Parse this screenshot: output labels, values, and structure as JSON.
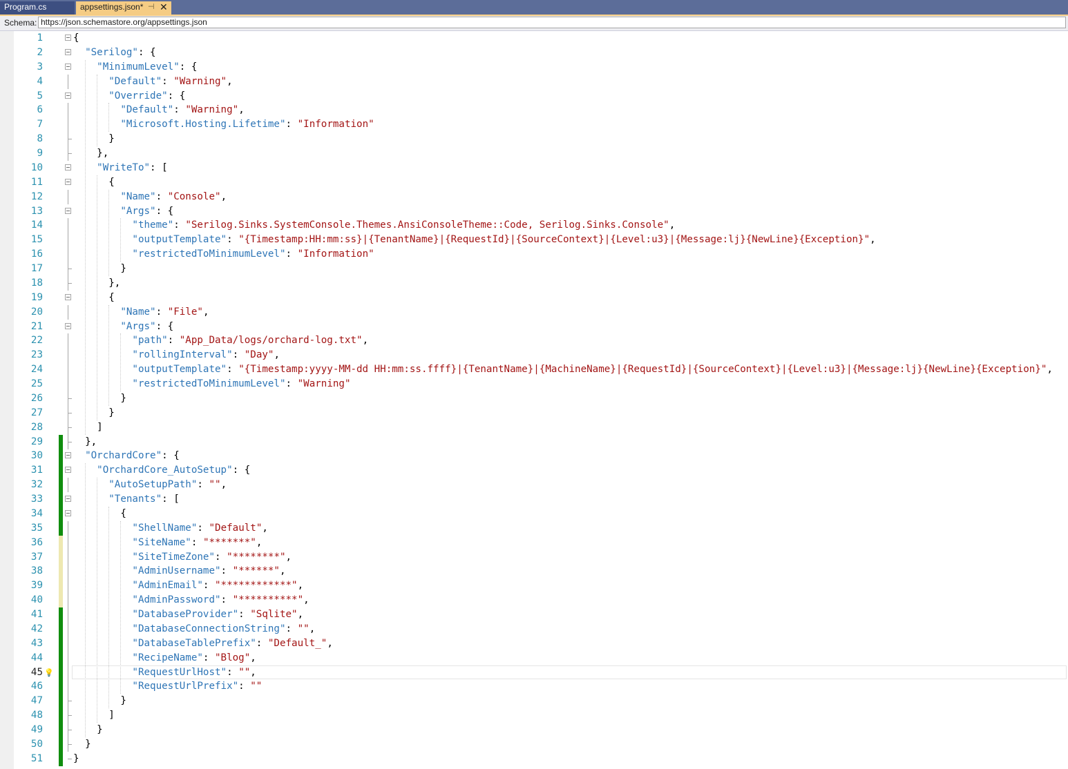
{
  "tabs": [
    {
      "label": "Program.cs"
    },
    {
      "label": "appsettings.json*",
      "pin": "⊣",
      "close": "✕"
    }
  ],
  "schema": {
    "label": "Schema:",
    "value": "https://json.schemastore.org/appsettings.json"
  },
  "editor": {
    "current_line": 45,
    "colors": {
      "key": "#2e75b6",
      "string": "#a31515",
      "punct": "#000000",
      "line_number": "#2b91af",
      "change_saved": "#108d0e",
      "change_unsaved": "#eee8b1"
    },
    "fold_markers": [
      1,
      2,
      3,
      5,
      10,
      11,
      13,
      19,
      21,
      30,
      31,
      33,
      34
    ],
    "saved_change_lines": [
      29,
      30,
      31,
      32,
      33,
      34,
      35,
      41,
      42,
      43,
      44,
      45,
      46,
      47,
      48,
      49,
      50,
      51
    ],
    "unsaved_change_lines": [
      36,
      37,
      38,
      39,
      40
    ],
    "lines": [
      {
        "n": "1",
        "tokens": [
          [
            "p",
            "{"
          ]
        ]
      },
      {
        "n": "2",
        "tokens": [
          [
            "p",
            "  "
          ],
          [
            "k",
            "\"Serilog\""
          ],
          [
            "p",
            ": {"
          ]
        ]
      },
      {
        "n": "3",
        "tokens": [
          [
            "p",
            "    "
          ],
          [
            "k",
            "\"MinimumLevel\""
          ],
          [
            "p",
            ": {"
          ]
        ]
      },
      {
        "n": "4",
        "tokens": [
          [
            "p",
            "      "
          ],
          [
            "k",
            "\"Default\""
          ],
          [
            "p",
            ": "
          ],
          [
            "s",
            "\"Warning\""
          ],
          [
            "p",
            ","
          ]
        ]
      },
      {
        "n": "5",
        "tokens": [
          [
            "p",
            "      "
          ],
          [
            "k",
            "\"Override\""
          ],
          [
            "p",
            ": {"
          ]
        ]
      },
      {
        "n": "6",
        "tokens": [
          [
            "p",
            "        "
          ],
          [
            "k",
            "\"Default\""
          ],
          [
            "p",
            ": "
          ],
          [
            "s",
            "\"Warning\""
          ],
          [
            "p",
            ","
          ]
        ]
      },
      {
        "n": "7",
        "tokens": [
          [
            "p",
            "        "
          ],
          [
            "k",
            "\"Microsoft.Hosting.Lifetime\""
          ],
          [
            "p",
            ": "
          ],
          [
            "s",
            "\"Information\""
          ]
        ]
      },
      {
        "n": "8",
        "tokens": [
          [
            "p",
            "      }"
          ]
        ]
      },
      {
        "n": "9",
        "tokens": [
          [
            "p",
            "    },"
          ]
        ]
      },
      {
        "n": "10",
        "tokens": [
          [
            "p",
            "    "
          ],
          [
            "k",
            "\"WriteTo\""
          ],
          [
            "p",
            ": ["
          ]
        ]
      },
      {
        "n": "11",
        "tokens": [
          [
            "p",
            "      {"
          ]
        ]
      },
      {
        "n": "12",
        "tokens": [
          [
            "p",
            "        "
          ],
          [
            "k",
            "\"Name\""
          ],
          [
            "p",
            ": "
          ],
          [
            "s",
            "\"Console\""
          ],
          [
            "p",
            ","
          ]
        ]
      },
      {
        "n": "13",
        "tokens": [
          [
            "p",
            "        "
          ],
          [
            "k",
            "\"Args\""
          ],
          [
            "p",
            ": {"
          ]
        ]
      },
      {
        "n": "14",
        "tokens": [
          [
            "p",
            "          "
          ],
          [
            "k",
            "\"theme\""
          ],
          [
            "p",
            ": "
          ],
          [
            "s",
            "\"Serilog.Sinks.SystemConsole.Themes.AnsiConsoleTheme::Code, Serilog.Sinks.Console\""
          ],
          [
            "p",
            ","
          ]
        ]
      },
      {
        "n": "15",
        "tokens": [
          [
            "p",
            "          "
          ],
          [
            "k",
            "\"outputTemplate\""
          ],
          [
            "p",
            ": "
          ],
          [
            "s",
            "\"{Timestamp:HH:mm:ss}|{TenantName}|{RequestId}|{SourceContext}|{Level:u3}|{Message:lj}{NewLine}{Exception}\""
          ],
          [
            "p",
            ","
          ]
        ]
      },
      {
        "n": "16",
        "tokens": [
          [
            "p",
            "          "
          ],
          [
            "k",
            "\"restrictedToMinimumLevel\""
          ],
          [
            "p",
            ": "
          ],
          [
            "s",
            "\"Information\""
          ]
        ]
      },
      {
        "n": "17",
        "tokens": [
          [
            "p",
            "        }"
          ]
        ]
      },
      {
        "n": "18",
        "tokens": [
          [
            "p",
            "      },"
          ]
        ]
      },
      {
        "n": "19",
        "tokens": [
          [
            "p",
            "      {"
          ]
        ]
      },
      {
        "n": "20",
        "tokens": [
          [
            "p",
            "        "
          ],
          [
            "k",
            "\"Name\""
          ],
          [
            "p",
            ": "
          ],
          [
            "s",
            "\"File\""
          ],
          [
            "p",
            ","
          ]
        ]
      },
      {
        "n": "21",
        "tokens": [
          [
            "p",
            "        "
          ],
          [
            "k",
            "\"Args\""
          ],
          [
            "p",
            ": {"
          ]
        ]
      },
      {
        "n": "22",
        "tokens": [
          [
            "p",
            "          "
          ],
          [
            "k",
            "\"path\""
          ],
          [
            "p",
            ": "
          ],
          [
            "s",
            "\"App_Data/logs/orchard-log.txt\""
          ],
          [
            "p",
            ","
          ]
        ]
      },
      {
        "n": "23",
        "tokens": [
          [
            "p",
            "          "
          ],
          [
            "k",
            "\"rollingInterval\""
          ],
          [
            "p",
            ": "
          ],
          [
            "s",
            "\"Day\""
          ],
          [
            "p",
            ","
          ]
        ]
      },
      {
        "n": "24",
        "tokens": [
          [
            "p",
            "          "
          ],
          [
            "k",
            "\"outputTemplate\""
          ],
          [
            "p",
            ": "
          ],
          [
            "s",
            "\"{Timestamp:yyyy-MM-dd HH:mm:ss.ffff}|{TenantName}|{MachineName}|{RequestId}|{SourceContext}|{Level:u3}|{Message:lj}{NewLine}{Exception}\""
          ],
          [
            "p",
            ","
          ]
        ]
      },
      {
        "n": "25",
        "tokens": [
          [
            "p",
            "          "
          ],
          [
            "k",
            "\"restrictedToMinimumLevel\""
          ],
          [
            "p",
            ": "
          ],
          [
            "s",
            "\"Warning\""
          ]
        ]
      },
      {
        "n": "26",
        "tokens": [
          [
            "p",
            "        }"
          ]
        ]
      },
      {
        "n": "27",
        "tokens": [
          [
            "p",
            "      }"
          ]
        ]
      },
      {
        "n": "28",
        "tokens": [
          [
            "p",
            "    ]"
          ]
        ]
      },
      {
        "n": "29",
        "tokens": [
          [
            "p",
            "  },"
          ]
        ]
      },
      {
        "n": "30",
        "tokens": [
          [
            "p",
            "  "
          ],
          [
            "k",
            "\"OrchardCore\""
          ],
          [
            "p",
            ": {"
          ]
        ]
      },
      {
        "n": "31",
        "tokens": [
          [
            "p",
            "    "
          ],
          [
            "k",
            "\"OrchardCore_AutoSetup\""
          ],
          [
            "p",
            ": {"
          ]
        ]
      },
      {
        "n": "32",
        "tokens": [
          [
            "p",
            "      "
          ],
          [
            "k",
            "\"AutoSetupPath\""
          ],
          [
            "p",
            ": "
          ],
          [
            "s",
            "\"\""
          ],
          [
            "p",
            ","
          ]
        ]
      },
      {
        "n": "33",
        "tokens": [
          [
            "p",
            "      "
          ],
          [
            "k",
            "\"Tenants\""
          ],
          [
            "p",
            ": ["
          ]
        ]
      },
      {
        "n": "34",
        "tokens": [
          [
            "p",
            "        {"
          ]
        ]
      },
      {
        "n": "35",
        "tokens": [
          [
            "p",
            "          "
          ],
          [
            "k",
            "\"ShellName\""
          ],
          [
            "p",
            ": "
          ],
          [
            "s",
            "\"Default\""
          ],
          [
            "p",
            ","
          ]
        ]
      },
      {
        "n": "36",
        "tokens": [
          [
            "p",
            "          "
          ],
          [
            "k",
            "\"SiteName\""
          ],
          [
            "p",
            ": "
          ],
          [
            "s",
            "\"*******\""
          ],
          [
            "p",
            ","
          ]
        ]
      },
      {
        "n": "37",
        "tokens": [
          [
            "p",
            "          "
          ],
          [
            "k",
            "\"SiteTimeZone\""
          ],
          [
            "p",
            ": "
          ],
          [
            "s",
            "\"********\""
          ],
          [
            "p",
            ","
          ]
        ]
      },
      {
        "n": "38",
        "tokens": [
          [
            "p",
            "          "
          ],
          [
            "k",
            "\"AdminUsername\""
          ],
          [
            "p",
            ": "
          ],
          [
            "s",
            "\"******\""
          ],
          [
            "p",
            ","
          ]
        ]
      },
      {
        "n": "39",
        "tokens": [
          [
            "p",
            "          "
          ],
          [
            "k",
            "\"AdminEmail\""
          ],
          [
            "p",
            ": "
          ],
          [
            "s",
            "\"************\""
          ],
          [
            "p",
            ","
          ]
        ]
      },
      {
        "n": "40",
        "tokens": [
          [
            "p",
            "          "
          ],
          [
            "k",
            "\"AdminPassword\""
          ],
          [
            "p",
            ": "
          ],
          [
            "s",
            "\"**********\""
          ],
          [
            "p",
            ","
          ]
        ]
      },
      {
        "n": "41",
        "tokens": [
          [
            "p",
            "          "
          ],
          [
            "k",
            "\"DatabaseProvider\""
          ],
          [
            "p",
            ": "
          ],
          [
            "s",
            "\"Sqlite\""
          ],
          [
            "p",
            ","
          ]
        ]
      },
      {
        "n": "42",
        "tokens": [
          [
            "p",
            "          "
          ],
          [
            "k",
            "\"DatabaseConnectionString\""
          ],
          [
            "p",
            ": "
          ],
          [
            "s",
            "\"\""
          ],
          [
            "p",
            ","
          ]
        ]
      },
      {
        "n": "43",
        "tokens": [
          [
            "p",
            "          "
          ],
          [
            "k",
            "\"DatabaseTablePrefix\""
          ],
          [
            "p",
            ": "
          ],
          [
            "s",
            "\"Default_\""
          ],
          [
            "p",
            ","
          ]
        ]
      },
      {
        "n": "44",
        "tokens": [
          [
            "p",
            "          "
          ],
          [
            "k",
            "\"RecipeName\""
          ],
          [
            "p",
            ": "
          ],
          [
            "s",
            "\"Blog\""
          ],
          [
            "p",
            ","
          ]
        ]
      },
      {
        "n": "45",
        "tokens": [
          [
            "p",
            "          "
          ],
          [
            "k",
            "\"RequestUrlHost\""
          ],
          [
            "p",
            ": "
          ],
          [
            "s",
            "\"\""
          ],
          [
            "p",
            ","
          ]
        ]
      },
      {
        "n": "46",
        "tokens": [
          [
            "p",
            "          "
          ],
          [
            "k",
            "\"RequestUrlPrefix\""
          ],
          [
            "p",
            ": "
          ],
          [
            "s",
            "\"\""
          ]
        ]
      },
      {
        "n": "47",
        "tokens": [
          [
            "p",
            "        }"
          ]
        ]
      },
      {
        "n": "48",
        "tokens": [
          [
            "p",
            "      ]"
          ]
        ]
      },
      {
        "n": "49",
        "tokens": [
          [
            "p",
            "    }"
          ]
        ]
      },
      {
        "n": "50",
        "tokens": [
          [
            "p",
            "  }"
          ]
        ]
      },
      {
        "n": "51",
        "tokens": [
          [
            "p",
            "}"
          ]
        ]
      }
    ]
  }
}
